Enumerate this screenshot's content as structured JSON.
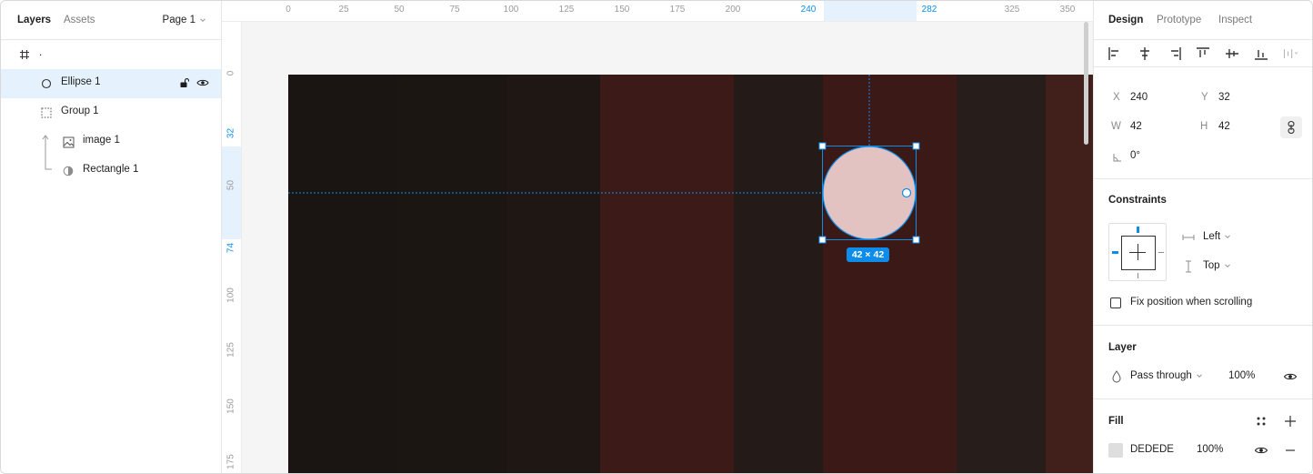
{
  "left_panel": {
    "tabs": [
      "Layers",
      "Assets"
    ],
    "page": "Page 1",
    "layers": [
      {
        "label": ".",
        "icon": "frame-icon"
      },
      {
        "label": "Ellipse 1",
        "icon": "ellipse-icon"
      },
      {
        "label": "Group 1",
        "icon": "group-icon"
      },
      {
        "label": "image 1",
        "icon": "image-icon"
      },
      {
        "label": "Rectangle 1",
        "icon": "mask-icon"
      }
    ]
  },
  "rulers": {
    "top": [
      "0",
      "25",
      "50",
      "75",
      "100",
      "125",
      "150",
      "175",
      "200",
      "240",
      "282",
      "325",
      "350"
    ],
    "left": [
      "0",
      "32",
      "50",
      "74",
      "100",
      "125",
      "150",
      "175"
    ]
  },
  "canvas": {
    "selection_size": "42 × 42",
    "ellipse_fill": "#E3C2C2",
    "selection_color": "#0D8CE9"
  },
  "right_panel": {
    "tabs": [
      "Design",
      "Prototype",
      "Inspect"
    ],
    "position": {
      "x_label": "X",
      "x": "240",
      "y_label": "Y",
      "y": "32",
      "w_label": "W",
      "w": "42",
      "h_label": "H",
      "h": "42",
      "rotation": "0°"
    },
    "constraints": {
      "title": "Constraints",
      "horizontal": "Left",
      "vertical": "Top",
      "fix_position_label": "Fix position when scrolling"
    },
    "layer": {
      "title": "Layer",
      "blend": "Pass through",
      "opacity": "100%"
    },
    "fill": {
      "title": "Fill",
      "hex": "DEDEDE",
      "opacity": "100%",
      "swatch": "#DEDEDE"
    }
  }
}
